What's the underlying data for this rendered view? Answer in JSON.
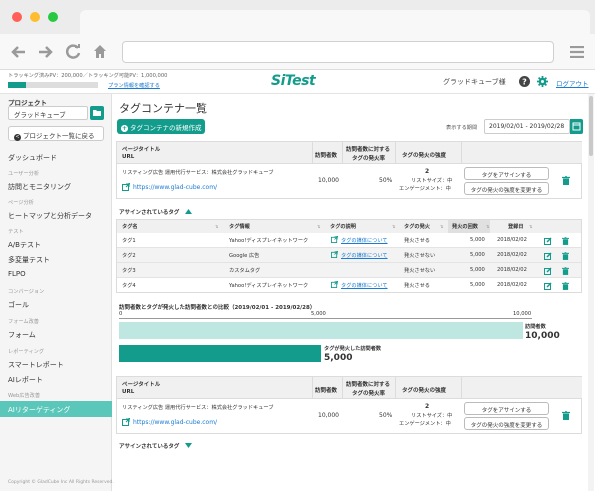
{
  "header": {
    "pv_text": "トラッキング済みPV：200,000／トラッキング可能PV：1,000,000",
    "pv_progress": 0.2,
    "plan_link": "プラン情報を確認する",
    "logo": "SiTest",
    "user": "グラッドキューブ様",
    "logout": "ログアウト"
  },
  "sidebar": {
    "project_label": "プロジェクト",
    "project_value": "グラッドキューブ",
    "back_button": "プロジェクト一覧に戻る",
    "dashboard": "ダッシュボード",
    "sec_user": "ユーザー分析",
    "access_monitoring": "訪問とモニタリング",
    "sec_page": "ページ分析",
    "heatmap": "ヒートマップと分析データ",
    "sec_test": "テスト",
    "abtest": "A/Bテスト",
    "multivariate": "多変量テスト",
    "flpo": "FLPO",
    "sec_conversion": "コンバージョン",
    "goal": "ゴール",
    "sec_form": "フォーム改善",
    "form": "フォーム",
    "sec_report": "レポーティング",
    "smart_report": "スマートレポート",
    "ai_report": "AIレポート",
    "sec_web": "Web広告改善",
    "ai_retargeting": "AIリターゲティング",
    "copyright": "Copyright © GladCube Inc All Rights Reserved."
  },
  "main": {
    "title": "タグコンテナ一覧",
    "new_button": "タグコンテナの新規作成",
    "period_label": "表示する期間",
    "period_value": "2019/02/01 - 2019/02/28",
    "col_page_title": "ページタイトル",
    "col_url": "URL",
    "col_visitors": "訪問者数",
    "col_ratio_1": "訪問者数に対する",
    "col_ratio_2": "タグの発火率",
    "col_strength": "タグの発火の強度",
    "container1": {
      "page_title": "リスティング広告 運用代行サービス：株式会社グラッドキューブ",
      "url": "https://www.glad-cube.com/",
      "visitors": "10,000",
      "ratio": "50%",
      "strength_num": "2",
      "strength_recency": "リストサイズ：中",
      "strength_engagement": "エンゲージメント：中",
      "assign_button": "タグをアサインする",
      "change_button": "タグの発火の強度を変更する"
    },
    "assigned_label": "アサインされているタグ",
    "tag_table": {
      "headers": [
        "タグ名",
        "タグ情報",
        "タグの説明",
        "タグの発火",
        "発火の回数",
        "登録日"
      ],
      "rows": [
        {
          "name": "タグ1",
          "info": "Yahoo!ディスプレイネットワーク",
          "desc": "タグの媒体について",
          "fire": "発火させる",
          "count": "5,000",
          "date": "2018/02/02"
        },
        {
          "name": "タグ2",
          "info": "Google 広告",
          "desc": "タグの媒体について",
          "fire": "発火させない",
          "count": "5,000",
          "date": "2018/02/02"
        },
        {
          "name": "タグ3",
          "info": "カスタムタグ",
          "desc": "",
          "fire": "発火させない",
          "count": "5,000",
          "date": "2018/02/02"
        },
        {
          "name": "タグ4",
          "info": "Yahoo!ディスプレイネットワーク",
          "desc": "タグの媒体について",
          "fire": "発火させる",
          "count": "5,000",
          "date": "2018/02/02"
        }
      ]
    },
    "comparison_title": "訪問者数とタグが発火した訪問者数との比較（2019/02/01 - 2019/02/28）",
    "container2": {
      "page_title": "リスティング広告 運用代行サービス：株式会社グラッドキューブ",
      "url": "https://www.glad-cube.com/",
      "visitors": "10,000",
      "ratio": "50%",
      "strength_num": "2",
      "strength_recency": "リストサイズ：中",
      "strength_engagement": "エンゲージメント：中",
      "assign_button": "タグをアサインする",
      "change_button": "タグの発火の強度を変更する"
    },
    "assigned_label_2": "アサインされているタグ"
  },
  "chart_data": {
    "type": "bar",
    "orientation": "horizontal",
    "title": "訪問者数とタグが発火した訪問者数との比較（2019/02/01 - 2019/02/28）",
    "x_ticks": [
      "0",
      "5,000",
      "10,000"
    ],
    "xlim": [
      0,
      10000
    ],
    "categories": [
      "訪問者数",
      "タグが発火した訪問者数"
    ],
    "values": [
      10000,
      5000
    ],
    "value_labels": [
      "10,000",
      "5,000"
    ],
    "colors": [
      "#bfe7e2",
      "#139c8c"
    ]
  },
  "colors": {
    "accent": "#139c8c",
    "link": "#1a7bd0",
    "active_sidebar": "#5bc7bb"
  }
}
